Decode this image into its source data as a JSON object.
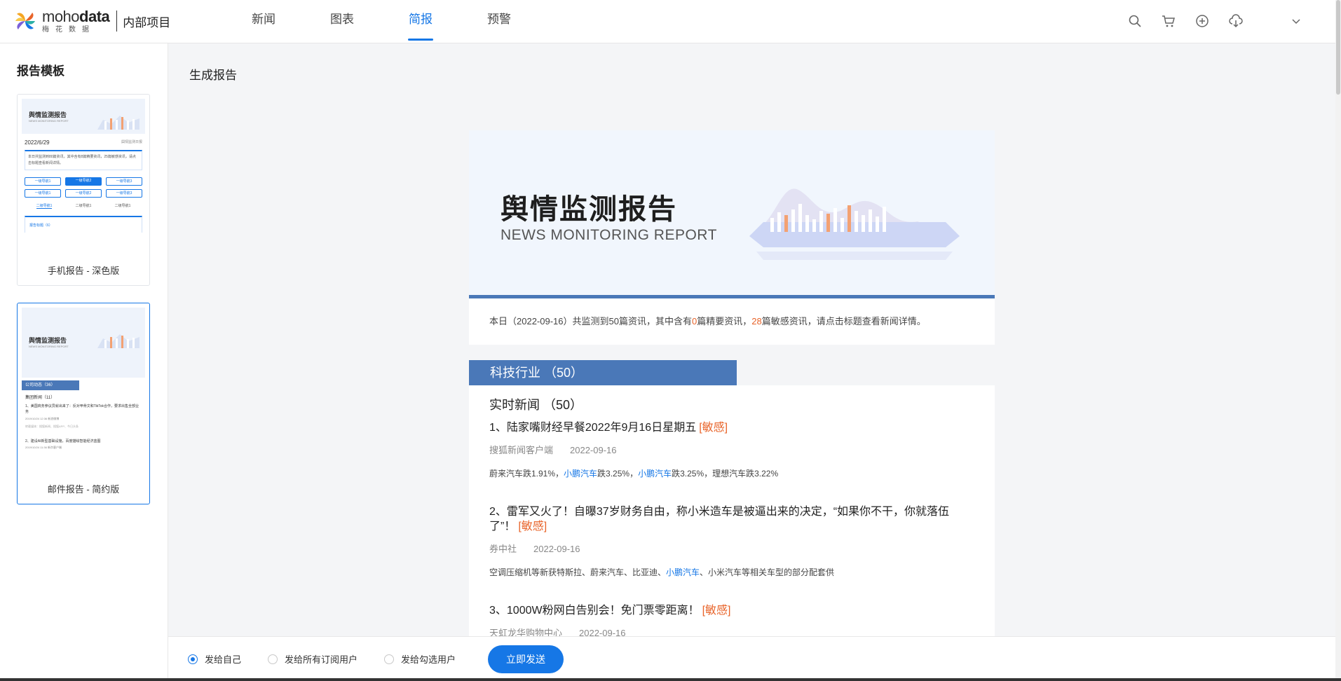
{
  "header": {
    "logo_en_light": "moho",
    "logo_en_bold": "data",
    "logo_cn": "梅花数据",
    "project": "内部项目",
    "nav": [
      {
        "label": "新闻",
        "active": false
      },
      {
        "label": "图表",
        "active": false
      },
      {
        "label": "简报",
        "active": true
      },
      {
        "label": "预警",
        "active": false
      }
    ],
    "tools": [
      "search-icon",
      "cart-icon",
      "plus-circle-icon",
      "cloud-download-icon",
      "chevron-down-icon"
    ]
  },
  "sidebar": {
    "title": "报告模板",
    "templates": [
      {
        "label": "手机报告 - 深色版",
        "selected": false,
        "thumb_title": "舆情监测报告",
        "thumb_sub": "NEWS MONITORING REPORT",
        "thumb_date": "2022/6/29",
        "thumb_tag": "舆情监测日报",
        "thumb_text": "本日共监测到80篇资讯，其中含有8篇精要资讯，25篇敏感资讯，请点击标题查看新闻详情。",
        "thumb_buttons": [
          "一级导航1",
          "一级导航2",
          "一级导航3",
          "一级导航1",
          "一级导航2",
          "一级导航3"
        ],
        "thumb_tabs": [
          "二级导航1",
          "二级导航1",
          "二级导航1"
        ],
        "thumb_footer": "报告标题（6）"
      },
      {
        "label": "邮件报告 - 简约版",
        "selected": true,
        "thumb_title": "舆情监测报告",
        "thumb_sub": "NEWS MONITORING REPORT",
        "thumb_section": "公司动态（36）",
        "thumb_group": "集团新闻（11）",
        "thumb_item1": "1、美国商务参议员就出来了：反对甲骨文和TikTok合作，要求出售全部业务",
        "thumb_item1_meta": "2019/10/24  12:36     新浪微博",
        "thumb_item1_extra": "转载媒体：搜狐新闻、搜狐APP、今日头条",
        "thumb_item2": "2、建设AI新型基础设施，百度描绘智能经济蓝图",
        "thumb_item2_meta": "2019/10/24  11:36     新京客户端"
      }
    ]
  },
  "main": {
    "title": "生成报告",
    "report": {
      "banner_title": "舆情监测报告",
      "banner_sub": "NEWS MONITORING REPORT",
      "summary": {
        "prefix": "本日（2022-09-16）共监测到50篇资讯，其中含有",
        "key_count": "0",
        "middle": "篇精要资讯，",
        "sensitive_count": "28",
        "suffix": "篇敏感资讯，请点击标题查看新闻详情。"
      },
      "section": "科技行业 （50）",
      "subsection": "实时新闻 （50）",
      "articles": [
        {
          "title": "1、陆家嘴财经早餐2022年9月16日星期五",
          "tag": "[敏感]",
          "source": "搜狐新闻客户端",
          "date": "2022-09-16",
          "body": [
            {
              "text": "蔚来汽车跌1.91%，",
              "link": false
            },
            {
              "text": "小鹏汽车",
              "link": true
            },
            {
              "text": "跌3.25%，",
              "link": false
            },
            {
              "text": "小鹏汽车",
              "link": true
            },
            {
              "text": "跌3.25%，理想汽车跌3.22%",
              "link": false
            }
          ]
        },
        {
          "title": "2、雷军又火了！自曝37岁财务自由，称小米造车是被逼出来的决定，“如果你不干，你就落伍了”！",
          "tag": "[敏感]",
          "source": "券中社",
          "date": "2022-09-16",
          "body": [
            {
              "text": "空调压缩机等新获特斯拉、蔚来汽车、比亚迪、",
              "link": false
            },
            {
              "text": "小鹏汽车",
              "link": true
            },
            {
              "text": "、小米汽车等相关车型的部分配套供",
              "link": false
            }
          ]
        },
        {
          "title": "3、1000W粉网白告别会！免门票零距离！",
          "tag": "[敏感]",
          "source": "天虹龙华购物中心",
          "date": "2022-09-16",
          "body": []
        }
      ]
    }
  },
  "sendbar": {
    "options": [
      {
        "label": "发给自己",
        "checked": true
      },
      {
        "label": "发给所有订阅用户",
        "checked": false
      },
      {
        "label": "发给勾选用户",
        "checked": false
      }
    ],
    "send_label": "立即发送"
  },
  "colors": {
    "accent": "#1677e6",
    "report_blue": "#4a78b8",
    "sensitive": "#e8642a"
  }
}
